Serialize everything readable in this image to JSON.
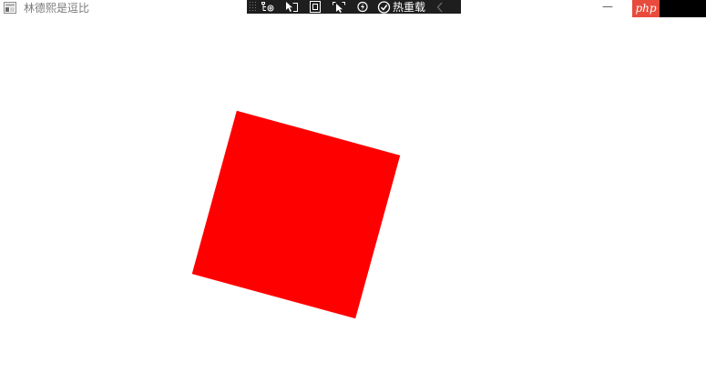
{
  "window": {
    "title": "林德熙是逗比",
    "minimize_symbol": "—"
  },
  "badge": {
    "text": "php"
  },
  "debug_toolbar": {
    "buttons": [
      {
        "icon": "live-visual-tree-icon"
      },
      {
        "icon": "select-element-icon"
      },
      {
        "icon": "display-layout-adorners-icon"
      },
      {
        "icon": "track-focused-element-icon"
      },
      {
        "icon": "hot-reload-icon"
      }
    ],
    "hot_reload_label": "热重载",
    "hot_reload_checked": true
  },
  "shape": {
    "color": "#ff0000",
    "rotation_degrees": 15.3
  },
  "colors": {
    "toolbar_bg": "#1e1e1e",
    "badge_bg": "#e84b3c",
    "shape_fill": "#ff0000"
  }
}
